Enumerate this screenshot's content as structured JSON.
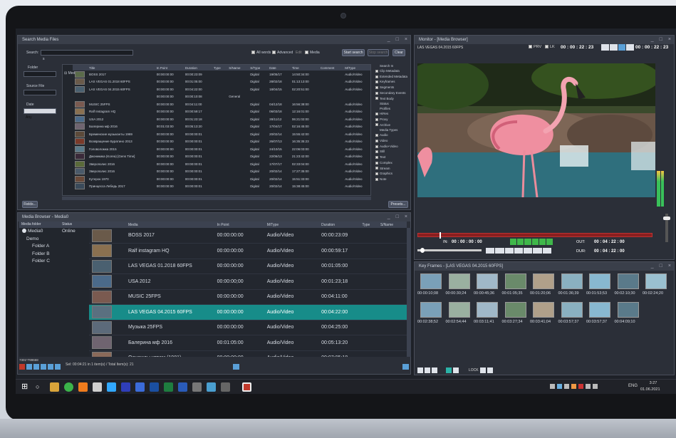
{
  "search": {
    "title": "Search Media Files",
    "search_label": "Search:",
    "search_value": "s",
    "opt_allwords": "All words",
    "opt_advanced": "Advanced",
    "opt_edit": "Edit",
    "opt_media": "Media",
    "btn_start": "Start search",
    "btn_stop": "Stop search",
    "btn_clear": "Clear",
    "side_folder": "Folder",
    "side_source": "Source File",
    "side_date": "Date",
    "side_date_value": "Any",
    "btn_fields": "Fields...",
    "btn_presets": "Presets...",
    "tree_root": "Media0",
    "headers": [
      "Title",
      "In Point",
      "Duration",
      "Type",
      "S/Name",
      "S/Type",
      "Date",
      "Time",
      "Comment",
      "M/Type"
    ],
    "rows": [
      [
        "BOSS 2017",
        "00:00:00:00",
        "00:00:23:09",
        "",
        "",
        "Digital",
        "19/05/17",
        "14:50:34:00",
        "",
        "Audio/Video"
      ],
      [
        "LAS VEGAS 01.2018 60FPS",
        "00:00:00:00",
        "00:01:05:00",
        "",
        "",
        "Digital",
        "28/02/18",
        "01:13:13:00",
        "",
        "Audio/Video"
      ],
      [
        "LAS VEGAS 04.2015 60FPS",
        "00:00:00:00",
        "00:04:22:00",
        "",
        "",
        "Digital",
        "18/04/15",
        "02:20:51:00",
        "",
        "Audio/Video"
      ],
      [
        "",
        "00:00:00:00",
        "00:00:10:08",
        "",
        "General",
        "",
        "",
        "",
        "",
        ""
      ],
      [
        "MUSIC 25FPS",
        "00:00:00:00",
        "00:04:11:00",
        "",
        "",
        "Digital",
        "04/12/18",
        "16:56:38:00",
        "",
        "Audio/Video"
      ],
      [
        "Ralf Instagram HQ",
        "00:00:00:00",
        "00:00:59:17",
        "",
        "",
        "Digital",
        "06/03/18",
        "12:16:01:00",
        "",
        "Audio/Video"
      ],
      [
        "USA 2012",
        "00:00:00:00",
        "00:01:23:18",
        "",
        "",
        "Digital",
        "28/11/12",
        "06:21:02:00",
        "",
        "Audio/Video"
      ],
      [
        "Балерина мф 2016",
        "00:01:03:00",
        "00:05:13:20",
        "",
        "",
        "Digital",
        "17/04/17",
        "02:16:45:00",
        "",
        "Audio/Video"
      ],
      [
        "Бременские музыканты 1969",
        "00:00:00:00",
        "00:00:00:01",
        "",
        "",
        "Digital",
        "20/02/14",
        "15:55:42:00",
        "",
        "Audio/Video"
      ],
      [
        "Возвращение Буратино 2013",
        "00:00:00:00",
        "00:00:00:01",
        "",
        "",
        "Digital",
        "26/07/13",
        "16:35:35:23",
        "",
        "Audio/Video"
      ],
      [
        "Головоломка 2015",
        "00:00:00:00",
        "00:00:00:01",
        "",
        "",
        "Digital",
        "24/10/15",
        "22:06:03:00",
        "",
        "Audio/Video"
      ],
      [
        "Джоникика (Korea) [Gens Time]",
        "00:00:00:00",
        "00:00:00:01",
        "",
        "",
        "Digital",
        "22/06/13",
        "21:23:42:00",
        "",
        "Audio/Video"
      ],
      [
        "Зверополис 2016",
        "00:00:00:00",
        "00:00:00:01",
        "",
        "",
        "Digital",
        "17/07/17",
        "02:33:04:00",
        "",
        "Audio/Video"
      ],
      [
        "Зверополис 2016",
        "00:00:00:00",
        "00:00:00:01",
        "",
        "",
        "Digital",
        "20/02/14",
        "17:27:35:00",
        "",
        "Audio/Video"
      ],
      [
        "Кутерок 1970",
        "00:00:00:00",
        "00:00:00:01",
        "",
        "",
        "Digital",
        "20/02/14",
        "15:51:33:00",
        "",
        "Audio/Video"
      ],
      [
        "Принцесса Лебедь 2017",
        "00:00:00:00",
        "00:00:00:01",
        "",
        "",
        "Digital",
        "20/02/14",
        "15:38:45:00",
        "",
        "Audio/Video"
      ]
    ],
    "right_group1": "Search In",
    "right_opts1": [
      "Clip Metadata",
      "Extended Metadata",
      "Keyframes",
      "Segments",
      "Secondary Events",
      "Text Body"
    ],
    "right_group2": "Status",
    "right_group3": "Profiles",
    "right_opts3": [
      "HiRes",
      "Proxy",
      "Archive"
    ],
    "right_group4": "Media Types",
    "right_opts4": [
      "Audio",
      "Video",
      "Audio+Video",
      "Still",
      "Text",
      "Complex",
      "Stream",
      "Graphics",
      "Note"
    ]
  },
  "browser": {
    "title": "Media Browser - Media0",
    "tree_headers": [
      "Media folder",
      "Status"
    ],
    "tree": [
      {
        "label": "Media0",
        "status": "Online"
      },
      {
        "label": "Demo",
        "status": ""
      },
      {
        "label": "Folder A",
        "status": ""
      },
      {
        "label": "Folder B",
        "status": ""
      },
      {
        "label": "Folder C",
        "status": ""
      }
    ],
    "headers": [
      "Media",
      "In Point",
      "M/Type",
      "Duration",
      "Type",
      "S/Name",
      "S/Type",
      "MDate",
      "MTime"
    ],
    "rows": [
      [
        "BOSS 2017",
        "00:00:00:00",
        "Audio/Video",
        "00:00:23:09",
        "",
        "",
        "Digital",
        "31.05.2021",
        "04:21:"
      ],
      [
        "Ralf instagram HQ",
        "00:00:00:00",
        "Audio/Video",
        "00:00:59:17",
        "",
        "",
        "Digital",
        "30.05.2021",
        "01:37:"
      ],
      [
        "LAS VEGAS 01.2018 60FPS",
        "00:00:00:00",
        "Audio/Video",
        "00:01:05:00",
        "",
        "",
        "Digital",
        "30.05.2021",
        "01:37:"
      ],
      [
        "USA 2012",
        "00:00:00;00",
        "Audio/Video",
        "00:01:23;18",
        "",
        "",
        "Digital",
        "30.05.2021",
        "01:37:"
      ],
      [
        "MUSIC 25FPS",
        "00:00:00:00",
        "Audio/Video",
        "00:04:11:00",
        "",
        "",
        "Digital",
        "30.05.2021",
        "01:39:"
      ],
      [
        "LAS VEGAS 04.2015 60FPS",
        "00:00:00:00",
        "Audio/Video",
        "00:04:22:00",
        "",
        "",
        "Digital",
        "30.05.2021",
        "01:38:"
      ],
      [
        "Музыка 25FPS",
        "00:00:00:00",
        "Audio/Video",
        "00:04:25:00",
        "",
        "",
        "Digital",
        "31.05.2021",
        "01:39:"
      ],
      [
        "Балерина мф 2016",
        "00:01:05:00",
        "Audio/Video",
        "00:05:13:20",
        "",
        "",
        "Digital",
        "30.05.2021",
        "01:51:"
      ],
      [
        "Однажды утром (1981)",
        "00:00:00:00",
        "Audio/Video",
        "00:07:05:18",
        "",
        "",
        "Digital",
        "30.05.2021",
        "04:51:"
      ]
    ],
    "status_left": "7301*799668",
    "status_sel": "Sel: 00:04:21 in 1 item(s) / Total Item(s): 21"
  },
  "monitor": {
    "title": "Monitor - [Media Browser]",
    "clip": "LAS VEGAS 04.2015 60FPS",
    "tc_top1": "00 : 00 : 22 : 23",
    "tc_top2": "00 : 00 : 22 : 23",
    "lbl_prv": "PRV",
    "lbl_lk": "LK",
    "lbl_in": "IN:",
    "lbl_out": "OUT:",
    "lbl_dur": "DUR:",
    "in_tc": "00 : 00 : 00 : 00",
    "out_tc": "00 : 04 : 22 : 00",
    "dur_tc": "00 : 04 : 22 : 00"
  },
  "keyframes": {
    "title": "Key Frames - [LAS VEGAS 04.2015 60FPS]",
    "row1": [
      "00:00:10;08",
      "00:00:30;24",
      "00:00:45;36",
      "00:01:05;35",
      "00:01:20;06",
      "00:01:36;39",
      "00:01:53;53",
      "00:02:10;30",
      "00:02:24;20"
    ],
    "row2": [
      "00:02:38;52",
      "00:02:54;44",
      "00:03:11;41",
      "00:03:27;34",
      "00:03:41;04",
      "00:03:57;37",
      "00:03:57;37",
      "00:04:09;10"
    ],
    "lock": "LOCK"
  },
  "taskbar": {
    "lang": "ENG",
    "time": "3:27",
    "date": "01.06.2021"
  },
  "colors": {
    "accent": "#178c89",
    "panel": "#2b2f38",
    "title": "#3a3f4a"
  }
}
